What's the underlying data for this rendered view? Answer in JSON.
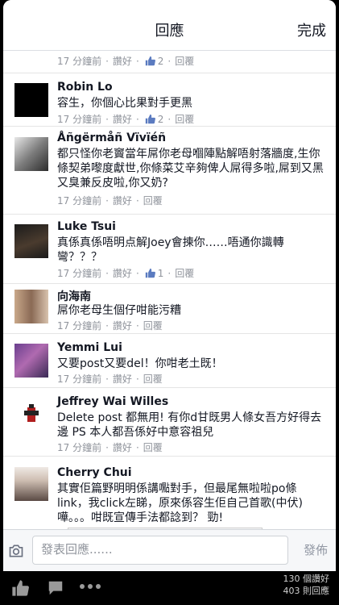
{
  "header": {
    "title": "回應",
    "done_label": "完成"
  },
  "actions": {
    "like": "讚好",
    "reply": "回覆"
  },
  "top_meta": {
    "time": "17 分鐘前",
    "likes": "2"
  },
  "comments": [
    {
      "name": "Robin Lo",
      "text": "容生，你個心比果對手更黑",
      "time": "17 分鐘前",
      "likes": "2"
    },
    {
      "name": "Åñgërmåñ Vïvïéñ",
      "text": "都只怪你老竇當年屌你老母嗰陣點解唔射落牆度,生你條契弟嚟度獻世,你條菜艾辛夠俾人屌得多啦,屌到又黑又臭兼反皮啦,你又奶?",
      "time": "17 分鐘前",
      "likes": ""
    },
    {
      "name": "Luke Tsui",
      "text": "真係真係唔明点解Joey會揀你……唔通你識轉彎？？？",
      "time": "17 分鐘前",
      "likes": "1"
    },
    {
      "name": "向海南",
      "text": "屌你老母生個仔咁能污糟",
      "time": "17 分鐘前",
      "likes": ""
    },
    {
      "name": "Yemmi Lui",
      "text": "又要post又要del！你咁老土既！",
      "time": "17 分鐘前",
      "likes": ""
    },
    {
      "name": "Jeffrey Wai Willes",
      "text": "Delete post 都無用! 有你d甘既男人條女吾方好得去邊 PS 本人都吾係好中意容祖兒",
      "time": "17 分鐘前",
      "likes": ""
    },
    {
      "name": "Cherry Chui",
      "text": "其實佢篇野明明係講嚸對手，但最尾無啦啦po條link，我click左睇，原來係容生佢自己首歌(中伏)嘩。。。咁既宣傳手法都諗到？ 勁!",
      "time": "",
      "likes": ""
    }
  ],
  "composer": {
    "placeholder": "發表回應......",
    "post_label": "發佈"
  },
  "footer": {
    "likes_text": "130 個讚好",
    "comments_text": "403 則回應"
  },
  "colors": {
    "accent": "#5b7bc0",
    "meta": "#90949c",
    "text": "#141823"
  }
}
